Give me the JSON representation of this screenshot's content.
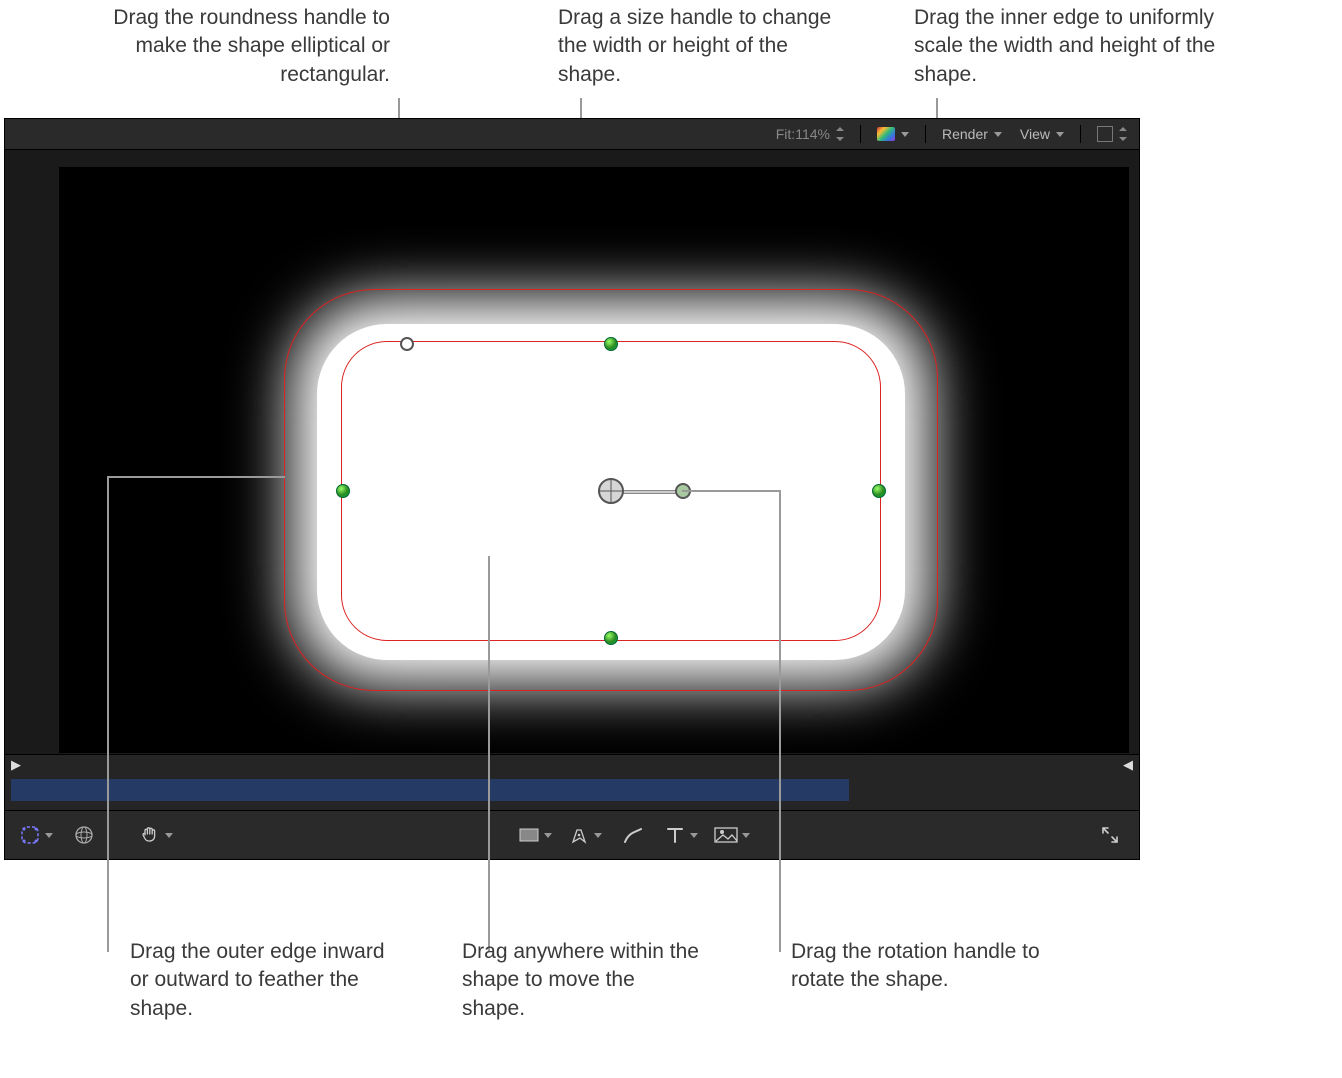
{
  "callouts": {
    "roundness": "Drag the roundness handle to make the shape elliptical or rectangular.",
    "size": "Drag a size handle to change the width or height of the shape.",
    "inner_edge": "Drag the inner edge to uniformly scale the width and height of the shape.",
    "outer_edge": "Drag the outer edge inward or outward to feather the shape.",
    "move": "Drag anywhere within the shape to move the shape.",
    "rotate": "Drag the rotation handle to rotate the shape."
  },
  "toolbar_top": {
    "fit_label": "Fit:",
    "zoom_value": "114%",
    "render_label": "Render",
    "view_label": "View"
  },
  "toolbar_bottom": {
    "transform_tool": "transform",
    "shape_mode": "shape-mask"
  },
  "play_markers": {
    "in": "▶",
    "out": "◀"
  },
  "icons": {
    "color_channels": "color-channels-icon",
    "channel_box": "channel-box-icon",
    "mask_tool": "mask-tool-icon",
    "sphere_tool": "3d-transform-icon",
    "hand_tool": "hand-tool-icon",
    "rect_tool": "rectangle-tool-icon",
    "pen_tool": "pen-tool-icon",
    "brush_tool": "paint-stroke-tool-icon",
    "text_tool": "text-tool-icon",
    "image_adjust": "image-adjust-tool-icon",
    "fullscreen": "fullscreen-icon"
  }
}
